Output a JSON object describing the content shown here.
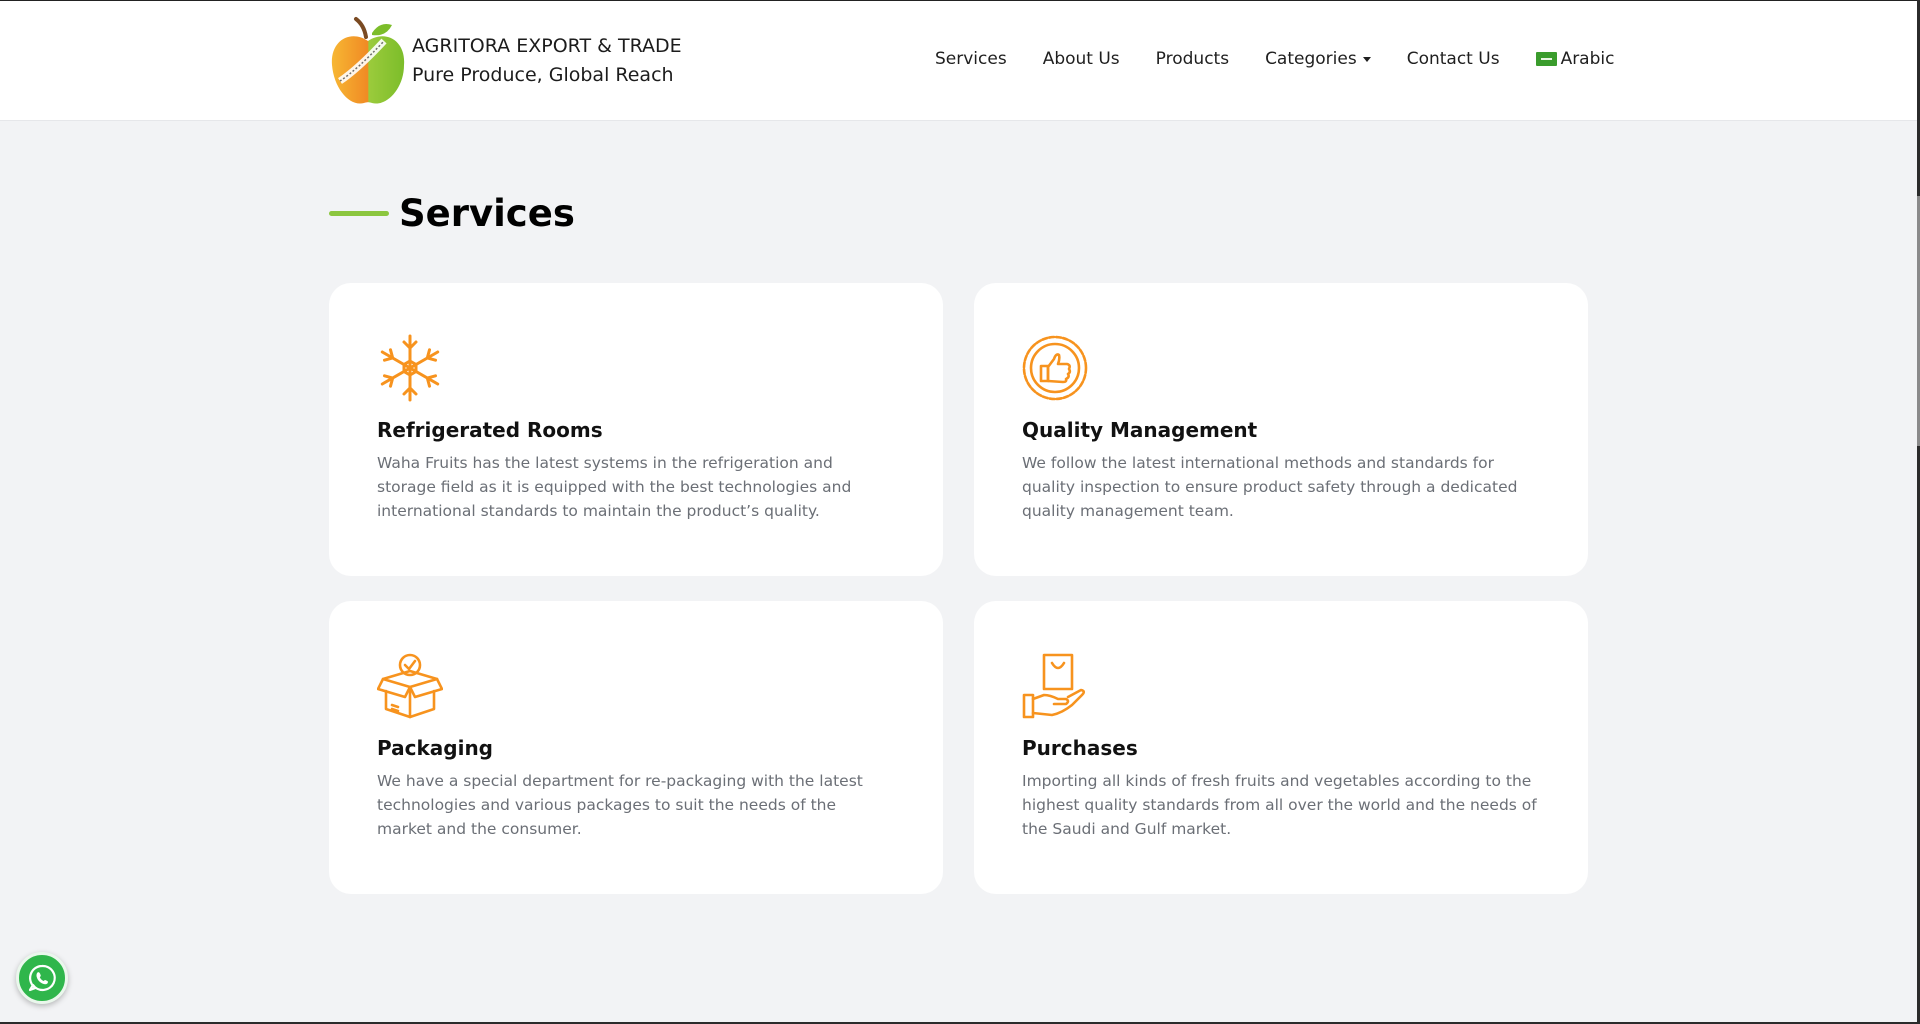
{
  "header": {
    "brand_name": "AGRITORA EXPORT & TRADE",
    "brand_tagline": "Pure Produce, Global Reach",
    "logo_icon": "apple-logo-icon"
  },
  "nav": {
    "services": "Services",
    "about": "About Us",
    "products": "Products",
    "categories": "Categories",
    "contact": "Contact Us",
    "language": "Arabic",
    "language_icon": "flag-icon"
  },
  "section": {
    "title": "Services",
    "accent_color": "#8cc63f"
  },
  "services": [
    {
      "icon": "snowflake-icon",
      "title": "Refrigerated Rooms",
      "description": "Waha Fruits has the latest systems in the refrigeration and storage field as it is equipped with the best technologies and international standards to maintain the product’s quality."
    },
    {
      "icon": "thumbs-up-badge-icon",
      "title": "Quality Management",
      "description": "We follow the latest international methods and standards for quality inspection to ensure product safety through a dedicated quality management team."
    },
    {
      "icon": "box-check-icon",
      "title": "Packaging",
      "description": "We have a special department for re-packaging with the latest technologies and various packages to suit the needs of the market and the consumer."
    },
    {
      "icon": "hand-bag-icon",
      "title": "Purchases",
      "description": "Importing all kinds of fresh fruits and vegetables according to the highest quality standards from all over the world and the needs of the Saudi and Gulf market."
    }
  ],
  "colors": {
    "icon_orange": "#f7931e",
    "background": "#f2f3f5",
    "whatsapp_green": "#2fb64b"
  },
  "floating": {
    "whatsapp_icon": "whatsapp-icon"
  }
}
